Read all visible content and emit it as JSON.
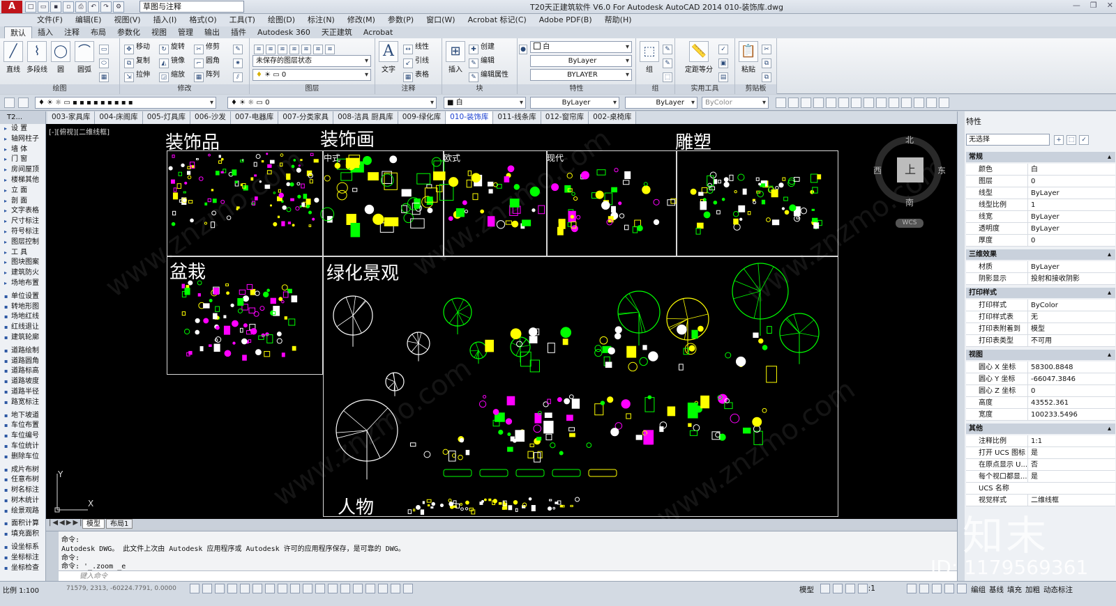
{
  "window": {
    "title": "T20天正建筑软件 V6.0 For Autodesk AutoCAD 2014    010-装饰库.dwg",
    "workspace": "草图与注释",
    "logo": "A"
  },
  "menu": [
    "文件(F)",
    "编辑(E)",
    "视图(V)",
    "插入(I)",
    "格式(O)",
    "工具(T)",
    "绘图(D)",
    "标注(N)",
    "修改(M)",
    "参数(P)",
    "窗口(W)",
    "Acrobat 标记(C)",
    "Adobe PDF(B)",
    "帮助(H)"
  ],
  "ribbon_tabs": [
    "默认",
    "插入",
    "注释",
    "布局",
    "参数化",
    "视图",
    "管理",
    "输出",
    "插件",
    "Autodesk 360",
    "天正建筑",
    "Acrobat"
  ],
  "ribbon": {
    "draw": {
      "title": "绘图",
      "line": "直线",
      "polyline": "多段线",
      "circle": "圆",
      "arc": "圆弧"
    },
    "modify": {
      "title": "修改",
      "move": "移动",
      "rotate": "旋转",
      "trim": "修剪",
      "copy": "复制",
      "mirror": "镜像",
      "fillet": "圆角",
      "stretch": "拉伸",
      "scale": "缩放",
      "array": "阵列"
    },
    "layers": {
      "title": "图层",
      "state": "未保存的图层状态",
      "current": "0"
    },
    "annotation": {
      "title": "注释",
      "text": "文字",
      "linear": "线性",
      "leader": "引线",
      "table": "表格"
    },
    "block": {
      "title": "块",
      "insert": "插入",
      "create": "创建",
      "edit": "编辑",
      "edit_attr": "编辑属性"
    },
    "properties": {
      "title": "特性",
      "color": "白",
      "linetype": "ByLayer",
      "lineweight": "BYLAYER"
    },
    "groups": {
      "title": "组",
      "group": "组"
    },
    "utilities": {
      "title": "实用工具",
      "measure": "定距等分"
    },
    "clipboard": {
      "title": "剪贴板",
      "paste": "粘贴"
    }
  },
  "toolbar2": {
    "layer": "0",
    "color": "白",
    "linetype": "ByLayer",
    "lineweight": "ByLayer",
    "plotstyle": "ByColor"
  },
  "leftbar": {
    "title": "T2...",
    "items": [
      "设    置",
      "轴网柱子",
      "墙    体",
      "门    窗",
      "房间屋顶",
      "楼梯其他",
      "立    面",
      "剖    面",
      "文字表格",
      "尺寸标注",
      "符号标注",
      "图层控制",
      "工    具",
      "图块图案",
      "建筑防火",
      "场地布置",
      "单位设置",
      "转地形图",
      "场地红线",
      "红线退让",
      "建筑轮廓",
      "道路绘制",
      "道路圆角",
      "道路标高",
      "道路坡度",
      "道路半径",
      "路宽标注",
      "地下坡道",
      "车位布置",
      "车位编号",
      "车位统计",
      "删除车位",
      "成片布树",
      "任意布树",
      "树名标注",
      "树木统计",
      "绘景观路",
      "面积计算",
      "填充面积",
      "设坐标系",
      "坐标标注",
      "坐标检查"
    ]
  },
  "drawing_tabs": [
    "003-家具库",
    "004-床阁库",
    "005-灯具库",
    "006-沙发",
    "007-电器库",
    "007-分类家具",
    "008-洁具 厨具库",
    "009-绿化库",
    "010-装饰库",
    "011-线条库",
    "012-窗帘库",
    "002-桌椅库"
  ],
  "active_drawing_tab": "010-装饰库",
  "canvas": {
    "viewport_label": "[-][俯视][二维线框]",
    "sections": {
      "decor": "装饰品",
      "paintings": "装饰画",
      "sculpture": "雕塑",
      "chinese": "中式",
      "european": "欧式",
      "modern": "现代",
      "bonsai": "盆栽",
      "landscape": "绿化景观",
      "people": "人物"
    },
    "viewcube": {
      "north": "北",
      "south": "南",
      "east": "东",
      "west": "西",
      "face": "上",
      "wcs": "WCS"
    },
    "ucs": {
      "x": "X",
      "y": "Y"
    }
  },
  "layout_tabs": {
    "model": "模型",
    "layout1": "布局1"
  },
  "command": {
    "lines": [
      "命令:",
      "Autodesk DWG。  此文件上次由 Autodesk 应用程序或 Autodesk 许可的应用程序保存，是可靠的 DWG。",
      "命令:",
      "命令: '_.zoom _e"
    ],
    "placeholder": "键入命令"
  },
  "status": {
    "scale": "比例 1:100",
    "coords": "71579, 2313, -60224.7791, 0.0000",
    "model": "模型",
    "anno_scale": "1:1",
    "right_labels": [
      "编组",
      "基线",
      "填充",
      "加粗",
      "动态标注"
    ]
  },
  "properties": {
    "title": "特性",
    "selection": "无选择",
    "sections": [
      {
        "name": "常规",
        "rows": [
          [
            "颜色",
            "白"
          ],
          [
            "图层",
            "0"
          ],
          [
            "线型",
            "ByLayer"
          ],
          [
            "线型比例",
            "1"
          ],
          [
            "线宽",
            "ByLayer"
          ],
          [
            "透明度",
            "ByLayer"
          ],
          [
            "厚度",
            "0"
          ]
        ]
      },
      {
        "name": "三维效果",
        "rows": [
          [
            "材质",
            "ByLayer"
          ],
          [
            "阴影显示",
            "投射和接收阴影"
          ]
        ]
      },
      {
        "name": "打印样式",
        "rows": [
          [
            "打印样式",
            "ByColor"
          ],
          [
            "打印样式表",
            "无"
          ],
          [
            "打印表附着到",
            "模型"
          ],
          [
            "打印表类型",
            "不可用"
          ]
        ]
      },
      {
        "name": "视图",
        "rows": [
          [
            "圆心 X 坐标",
            "58300.8848"
          ],
          [
            "圆心 Y 坐标",
            "-66047.3846"
          ],
          [
            "圆心 Z 坐标",
            "0"
          ],
          [
            "高度",
            "43552.361"
          ],
          [
            "宽度",
            "100233.5496"
          ]
        ]
      },
      {
        "name": "其他",
        "rows": [
          [
            "注释比例",
            "1:1"
          ],
          [
            "打开 UCS 图标",
            "是"
          ],
          [
            "在原点显示 U...",
            "否"
          ],
          [
            "每个视口都显...",
            "是"
          ],
          [
            "UCS 名称",
            ""
          ],
          [
            "视觉样式",
            "二维线框"
          ]
        ]
      }
    ]
  },
  "watermark": {
    "brand": "知末",
    "id": "ID: 1179569361",
    "diagonal": "www.znzmo.com"
  }
}
